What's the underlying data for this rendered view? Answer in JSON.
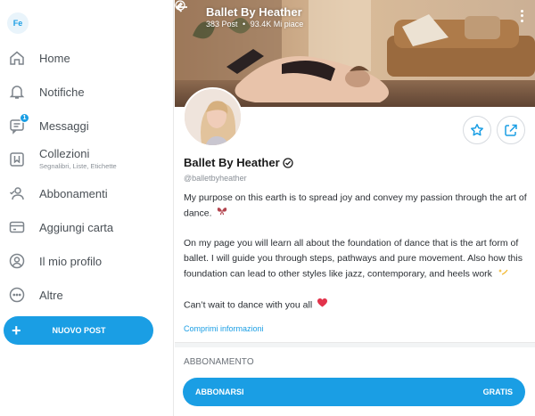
{
  "user": {
    "initials": "Fe"
  },
  "nav": [
    {
      "label": "Home",
      "icon": "home-icon"
    },
    {
      "label": "Notifiche",
      "icon": "bell-icon"
    },
    {
      "label": "Messaggi",
      "icon": "message-icon",
      "badge": "1"
    },
    {
      "label": "Collezioni",
      "sub": "Segnalibri, Liste, Etichette",
      "icon": "bookmark-icon"
    },
    {
      "label": "Abbonamenti",
      "icon": "subscriptions-icon"
    },
    {
      "label": "Aggiungi carta",
      "icon": "card-icon"
    },
    {
      "label": "Il mio profilo",
      "icon": "profile-icon"
    },
    {
      "label": "Altre",
      "icon": "more-icon"
    }
  ],
  "new_post_label": "NUOVO POST",
  "profile": {
    "name": "Ballet By Heather",
    "posts": "383 Post",
    "separator": "•",
    "likes": "93.4K Mi piace",
    "handle": "@balletbyheather",
    "bio": [
      "My purpose on this earth is to spread joy and convey my passion through the art of dance.",
      "On my page you will learn all about the foundation of dance that is the art form of ballet. I will guide you through steps, pathways and pure movement. Also how this foundation can lead to other styles like jazz, contemporary, and heels work",
      "Can’t wait to dance with you all"
    ],
    "more_info": "Comprimi informazioni"
  },
  "subscription": {
    "title": "ABBONAMENTO",
    "button_label": "ABBONARSI",
    "price_label": "GRATIS"
  },
  "colors": {
    "accent": "#1a9ee4",
    "text_muted": "#8a9097"
  }
}
